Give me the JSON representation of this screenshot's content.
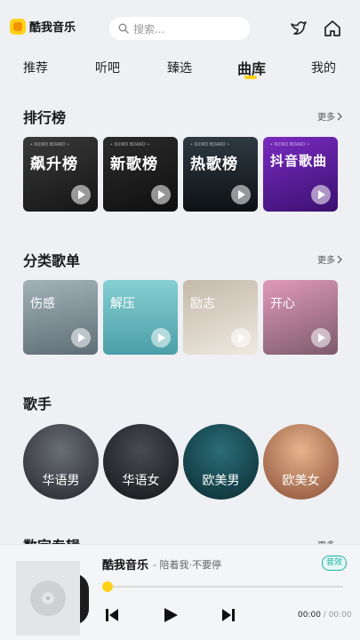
{
  "header": {
    "app_name": "酷我音乐",
    "search_placeholder": "搜索...",
    "icons": [
      "bird-icon",
      "home-icon"
    ]
  },
  "tabs": [
    {
      "label": "推荐",
      "active": false
    },
    {
      "label": "听吧",
      "active": false
    },
    {
      "label": "臻选",
      "active": false
    },
    {
      "label": "曲库",
      "active": true
    },
    {
      "label": "我的",
      "active": false
    }
  ],
  "charts": {
    "title": "排行榜",
    "more": "更多",
    "items": [
      {
        "label": "飙升榜",
        "sub": "• KUWO BOARD •",
        "color": "#2b2b2b"
      },
      {
        "label": "新歌榜",
        "sub": "• KUWO BOARD •",
        "color": "#1f1f1f"
      },
      {
        "label": "热歌榜",
        "sub": "• KUWO BOARD •",
        "color": "#222a30"
      },
      {
        "label": "抖音歌曲",
        "sub": "• KUWO BOARD •",
        "color": "#5b1f8f"
      }
    ]
  },
  "categories": {
    "title": "分类歌单",
    "more": "更多",
    "items": [
      {
        "label": "伤感",
        "color": "#7d8a90"
      },
      {
        "label": "解压",
        "color": "#6fb6bd"
      },
      {
        "label": "励志",
        "color": "#d8cfc3"
      },
      {
        "label": "开心",
        "color": "#c98aa6"
      }
    ]
  },
  "singers": {
    "title": "歌手",
    "items": [
      {
        "label": "华语男",
        "color": "#2b2f35"
      },
      {
        "label": "华语女",
        "color": "#1c1d22"
      },
      {
        "label": "欧美男",
        "color": "#123a42"
      },
      {
        "label": "欧美女",
        "color": "#c98a62"
      }
    ]
  },
  "albums": {
    "title": "数字专辑",
    "more": "更多"
  },
  "player": {
    "title": "酷我音乐",
    "subtitle": "- 陪着我·不要停",
    "quality": "音效",
    "current_time": "00:00",
    "separator": " / ",
    "total_time": "00:00",
    "progress": 0
  },
  "colors": {
    "accent": "#ffd21a",
    "background": "#eef0f3",
    "quality": "#19b3a8"
  }
}
